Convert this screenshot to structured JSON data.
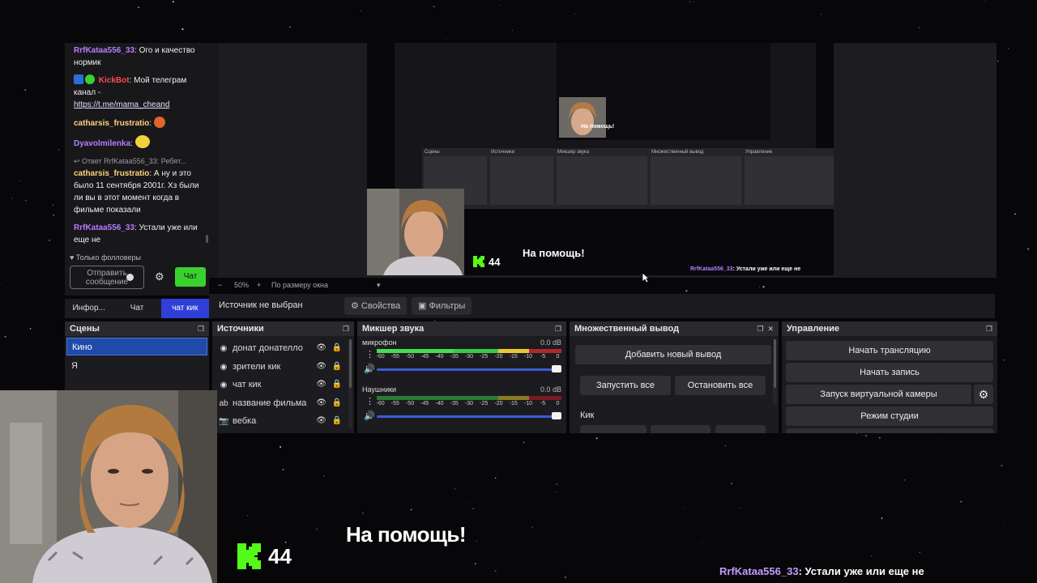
{
  "chat": {
    "messages": [
      {
        "user": "RrfKataa556_33",
        "text": ": Ого и качество нормик"
      },
      {
        "user": "KickBot",
        "text": ": Мой телеграм канал - ",
        "link": "https://t.me/mama_cheand"
      },
      {
        "user": "catharsis_frustratio",
        "text": ":"
      },
      {
        "user": "Dyavolmilenka",
        "text": ":"
      },
      {
        "reply": "Ответ RrfKataa556_33: Ребят...",
        "user": "catharsis_frustratio",
        "text": ": А ну и это было 11 сентября 2001г. Хз были ли вы в этот момент когда в фильме показали"
      },
      {
        "user": "RrfKataa556_33",
        "text": ": Устали уже или еще не"
      }
    ],
    "followers_only": "Только фолловеры",
    "input_placeholder": "Отправить сообщение",
    "send_label": "Чат"
  },
  "tabs": [
    "Инфор...",
    "Чат",
    "чат кик"
  ],
  "zoom": {
    "level": "50%",
    "fit": "По размеру окна",
    "minus": "−",
    "plus": "+"
  },
  "source_bar": {
    "status": "Источник не выбран",
    "properties": "Свойства",
    "filters": "Фильтры"
  },
  "scenes": {
    "title": "Сцены",
    "items": [
      "Кино",
      "Я"
    ]
  },
  "sources": {
    "title": "Источники",
    "items": [
      "донат донателло",
      "зрители кик",
      "чат кик",
      "название фильма",
      "вебка"
    ]
  },
  "mixer": {
    "title": "Микшер звука",
    "ticks": [
      "-60",
      "-55",
      "-50",
      "-45",
      "-40",
      "-35",
      "-30",
      "-25",
      "-20",
      "-15",
      "-10",
      "-5",
      "0"
    ],
    "channels": [
      {
        "name": "микрофон",
        "db": "0.0 dB"
      },
      {
        "name": "Наушники",
        "db": "0.0 dB"
      }
    ]
  },
  "multi": {
    "title": "Множественный вывод",
    "add": "Добавить новый вывод",
    "start_all": "Запустить все",
    "stop_all": "Остановить все",
    "section": "Кик"
  },
  "controls": {
    "title": "Управление",
    "stream": "Начать трансляцию",
    "record": "Начать запись",
    "virtualcam": "Запуск виртуальной камеры",
    "studio": "Режим студии"
  },
  "overlay": {
    "kick_count": "44",
    "help_text": "На помощь!",
    "chat_user": "RrfKataa556_33",
    "chat_text": ": Устали уже или еще не"
  },
  "colors": {
    "kick_green": "#53fc18",
    "accent_blue": "#2f3fd8",
    "panel": "#1c1c20"
  }
}
